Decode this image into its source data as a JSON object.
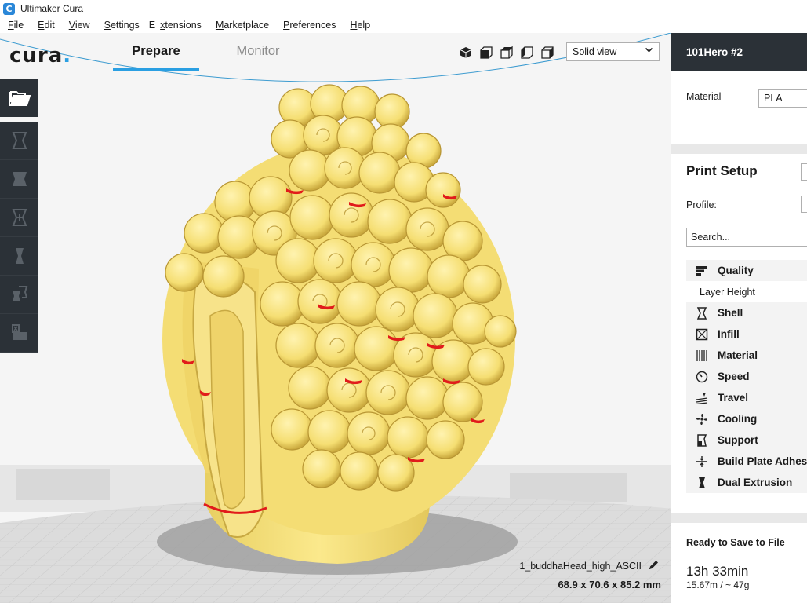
{
  "window": {
    "title": "Ultimaker Cura",
    "icon": "C"
  },
  "menu": [
    {
      "pre": "",
      "u": "F",
      "post": "ile"
    },
    {
      "pre": "",
      "u": "E",
      "post": "dit"
    },
    {
      "pre": "",
      "u": "V",
      "post": "iew"
    },
    {
      "pre": "",
      "u": "S",
      "post": "ettings"
    },
    {
      "pre": "E",
      "u": "x",
      "post": "tensions"
    },
    {
      "pre": "",
      "u": "M",
      "post": "arketplace"
    },
    {
      "pre": "",
      "u": "P",
      "post": "references"
    },
    {
      "pre": "",
      "u": "H",
      "post": "elp"
    }
  ],
  "header": {
    "logo_text": "cura",
    "logo_dot": ".",
    "tabs": {
      "prepare": "Prepare",
      "monitor": "Monitor"
    },
    "active_tab": "Prepare",
    "view_mode": "Solid view"
  },
  "model": {
    "name": "1_buddhaHead_high_ASCII",
    "dimensions": "68.9 x 70.6 x 85.2 mm"
  },
  "sidebar": {
    "machine": "101Hero #2",
    "material_label": "Material",
    "material_value": "PLA",
    "print_setup": "Print Setup",
    "profile_label": "Profile:",
    "search_placeholder": "Search...",
    "categories": {
      "quality": "Quality",
      "layer_height": "Layer Height",
      "shell": "Shell",
      "infill": "Infill",
      "material": "Material",
      "speed": "Speed",
      "travel": "Travel",
      "cooling": "Cooling",
      "support": "Support",
      "adhesion": "Build Plate Adhes",
      "dual": "Dual Extrusion"
    },
    "status": "Ready to Save to File",
    "print_time": "13h 33min",
    "usage": "15.67m / ~ 47g"
  },
  "colors": {
    "accent": "#2a9fe2",
    "model": "#f6e27d",
    "overhang": "#e11b1b",
    "toolbar": "#2b3137"
  }
}
